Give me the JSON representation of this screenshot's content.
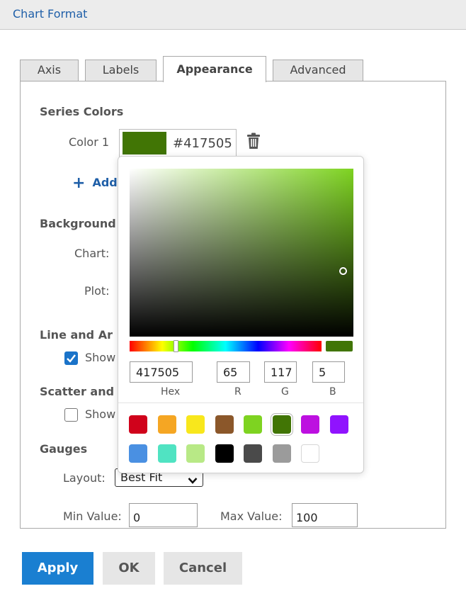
{
  "window": {
    "title": "Chart Format"
  },
  "tabs": [
    {
      "label": "Axis",
      "active": false
    },
    {
      "label": "Labels",
      "active": false
    },
    {
      "label": "Appearance",
      "active": true
    },
    {
      "label": "Advanced",
      "active": false
    }
  ],
  "series_colors": {
    "heading": "Series Colors",
    "color1_label": "Color 1",
    "color1_hex": "#417505",
    "add_label": "Add"
  },
  "background": {
    "heading": "Background",
    "chart_label": "Chart:",
    "plot_label": "Plot:"
  },
  "line_area": {
    "heading": "Line and Ar",
    "show_label": "Show",
    "checked": true
  },
  "scatter": {
    "heading": "Scatter and",
    "show_label": "Show",
    "checked": false
  },
  "gauges": {
    "heading": "Gauges",
    "layout_label": "Layout:",
    "layout_value": "Best Fit",
    "min_label": "Min Value:",
    "min_value": "0",
    "max_label": "Max Value:",
    "max_value": "100"
  },
  "picker": {
    "base_hue": "#7ed321",
    "preview_color": "#417505",
    "hex_value": "417505",
    "r_value": "65",
    "g_value": "117",
    "b_value": "5",
    "hex_label": "Hex",
    "r_label": "R",
    "g_label": "G",
    "b_label": "B",
    "presets": [
      "#d0021b",
      "#f5a623",
      "#f8e71c",
      "#8b572a",
      "#7ed321",
      "#417505",
      "#bd10e0",
      "#9013fe",
      "#4a90e2",
      "#50e3c2",
      "#b8e986",
      "#000000",
      "#4a4a4a",
      "#9b9b9b",
      "#ffffff"
    ]
  },
  "buttons": {
    "apply": "Apply",
    "ok": "OK",
    "cancel": "Cancel"
  },
  "colors": {
    "accent": "#1a7fd1",
    "title_blue": "#1f5fa8"
  }
}
